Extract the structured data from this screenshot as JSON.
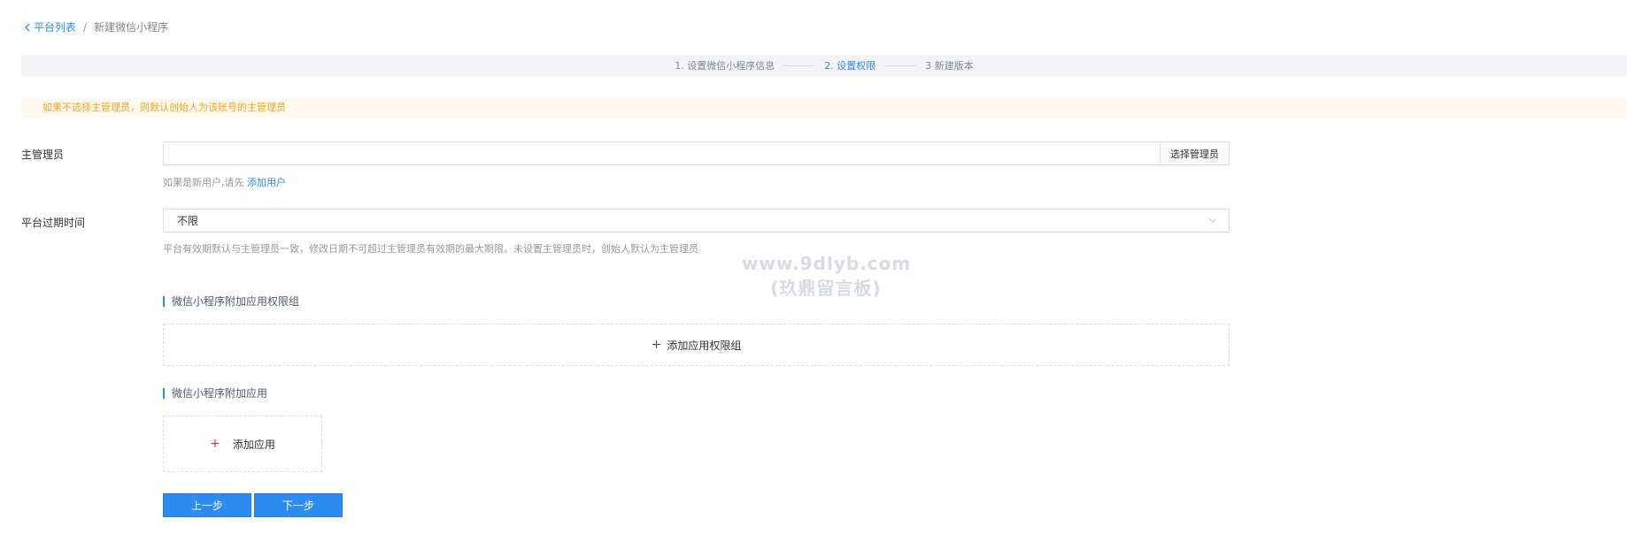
{
  "breadcrumb": {
    "back": "平台列表",
    "separator": "/",
    "current": "新建微信小程序"
  },
  "steps": [
    {
      "label": "1. 设置微信小程序信息",
      "active": false
    },
    {
      "label": "2. 设置权限",
      "active": true
    },
    {
      "label": "3 新建版本",
      "active": false
    }
  ],
  "notice": "如果不选择主管理员，则默认创始人为该账号的主管理员",
  "admin": {
    "label": "主管理员",
    "value": "",
    "button": "选择管理员",
    "hint_prefix": "如果是新用户,请先",
    "hint_link": "添加用户"
  },
  "expiry": {
    "label": "平台过期时间",
    "selected": "不限",
    "hint": "平台有效期默认与主管理员一致，修改日期不可超过主管理员有效期的最大期限。未设置主管理员时，创始人默认为主管理员"
  },
  "groups": {
    "title": "微信小程序附加应用权限组",
    "add": "添加应用权限组"
  },
  "apps": {
    "title": "微信小程序附加应用",
    "add": "添加应用"
  },
  "buttons": {
    "prev": "上一步",
    "next": "下一步"
  },
  "watermark": {
    "line1": "www.9dlyb.com",
    "line2": "(玖鼎留言板)"
  },
  "colors": {
    "primary": "#2d8cf0",
    "warning": "#f5a623",
    "notice_bg": "#fff9ef",
    "steps_bg": "#f3f4f7"
  }
}
